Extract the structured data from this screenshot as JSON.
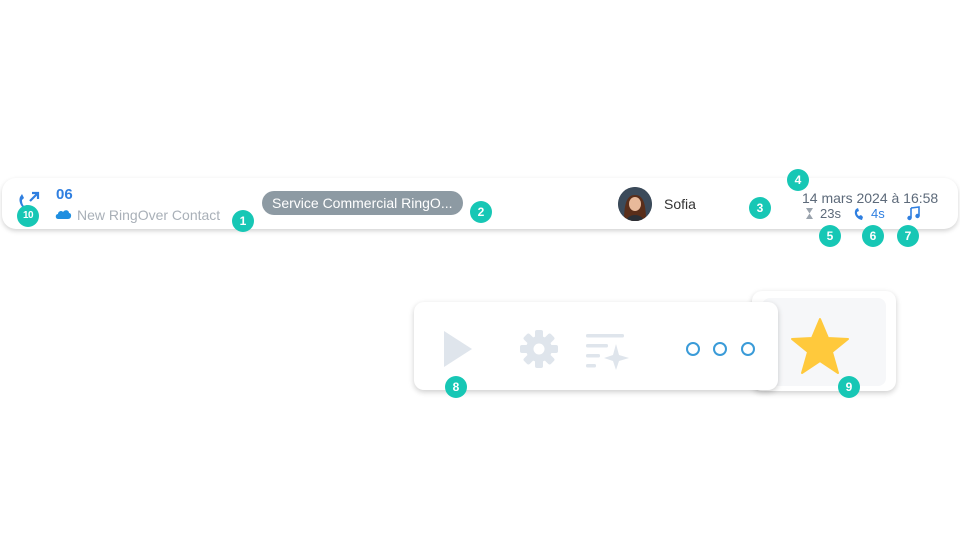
{
  "call": {
    "number": "06",
    "contact_name": "New RingOver Contact",
    "group_tag": "Service Commercial RingO...",
    "agent_name": "Sofia",
    "date_time": "14 mars 2024 à 16:58",
    "total_duration": "23s",
    "talk_duration": "4s"
  },
  "actions": {
    "play_icon": "play-icon",
    "settings_icon": "gear-icon",
    "transcript_icon": "ai-list-icon",
    "more_icon": "more-dots-icon",
    "favorite_icon": "star-icon"
  },
  "markers": [
    "1",
    "2",
    "3",
    "4",
    "5",
    "6",
    "7",
    "8",
    "9",
    "10"
  ],
  "colors": {
    "accent": "#2f7fe0",
    "marker": "#17c7b5",
    "star": "#ffc93c"
  }
}
